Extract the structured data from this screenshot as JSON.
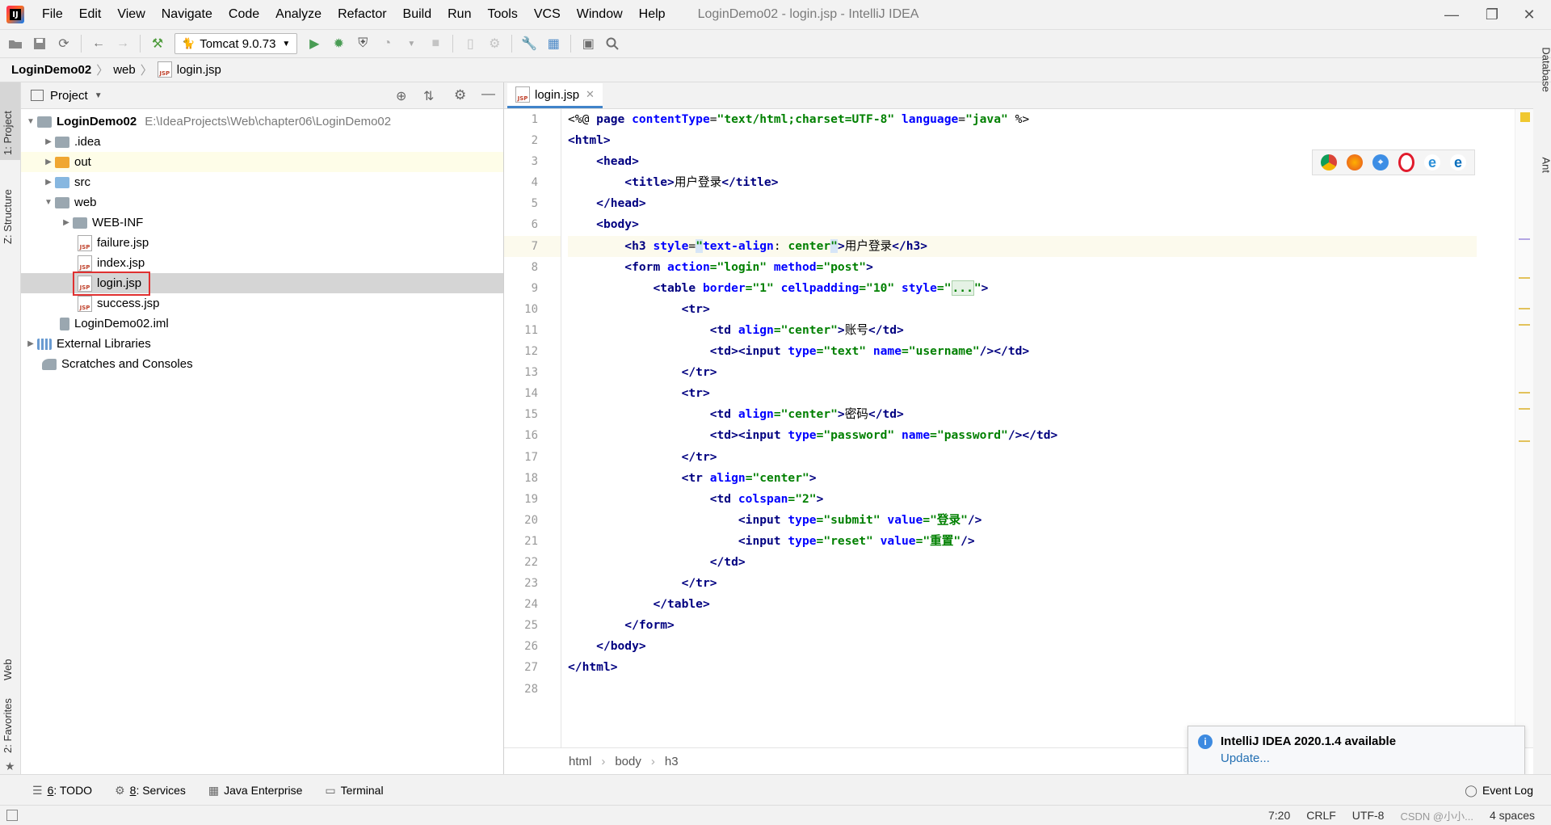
{
  "window": {
    "title": "LoginDemo02 - login.jsp - IntelliJ IDEA",
    "logo_text": "IJ",
    "controls": [
      "—",
      "❐",
      "✕"
    ]
  },
  "menu": [
    "File",
    "Edit",
    "View",
    "Navigate",
    "Code",
    "Analyze",
    "Refactor",
    "Build",
    "Run",
    "Tools",
    "VCS",
    "Window",
    "Help"
  ],
  "toolbar": {
    "run_config": "Tomcat 9.0.73"
  },
  "navbar": {
    "crumbs": [
      "LoginDemo02",
      "web",
      "login.jsp"
    ]
  },
  "left_strip": {
    "project_tab": "1: Project",
    "structure_tab": "Z: Structure",
    "web_tab": "Web",
    "favorites_tab": "2: Favorites"
  },
  "right_strip": {
    "database_tab": "Database",
    "ant_tab": "Ant"
  },
  "project_panel": {
    "title": "Project",
    "tree": [
      {
        "label": "LoginDemo02",
        "path": "E:\\IdeaProjects\\Web\\chapter06\\LoginDemo02",
        "icon": "module-folder"
      },
      {
        "label": ".idea",
        "icon": "folder"
      },
      {
        "label": "out",
        "icon": "folder-orange"
      },
      {
        "label": "src",
        "icon": "folder-blue"
      },
      {
        "label": "web",
        "icon": "web-folder"
      },
      {
        "label": "WEB-INF",
        "icon": "folder"
      },
      {
        "label": "failure.jsp",
        "icon": "jsp-file"
      },
      {
        "label": "index.jsp",
        "icon": "jsp-file"
      },
      {
        "label": "login.jsp",
        "icon": "jsp-file"
      },
      {
        "label": "success.jsp",
        "icon": "jsp-file"
      },
      {
        "label": "LoginDemo02.iml",
        "icon": "iml-file"
      },
      {
        "label": "External Libraries",
        "icon": "library"
      },
      {
        "label": "Scratches and Consoles",
        "icon": "scratches"
      }
    ],
    "jsp_badge": "JSP"
  },
  "editor": {
    "tab": "login.jsp",
    "line_numbers": [
      "1",
      "2",
      "3",
      "4",
      "5",
      "6",
      "7",
      "8",
      "9",
      "10",
      "11",
      "12",
      "13",
      "14",
      "15",
      "16",
      "17",
      "18",
      "19",
      "20",
      "21",
      "22",
      "23",
      "24",
      "25",
      "26",
      "27",
      "28"
    ],
    "code": {
      "l1": {
        "a": "<%@ ",
        "b": "page ",
        "c": "contentType",
        "d": "=",
        "e": "\"text/html;charset=UTF-8\"",
        "f": " language",
        "g": "=",
        "h": "\"java\"",
        "i": " %>"
      },
      "l2": "<html>",
      "l3": "<head>",
      "l4": {
        "open": "<title>",
        "text": "用户登录",
        "close": "</title>"
      },
      "l5": "</head>",
      "l6": "<body>",
      "l7": {
        "open": "<h3 ",
        "attr": "style",
        "eq": "=",
        "q1": "\"",
        "v1": "text-align",
        "colon": ": ",
        "v2": "center",
        "q2": "\"",
        "gt": ">",
        "text": "用户登录",
        "close": "</h3>"
      },
      "l8": {
        "open": "<form ",
        "a1": "action",
        "v1": "=\"login\"",
        "a2": " method",
        "v2": "=\"post\"",
        "gt": ">"
      },
      "l9": {
        "open": "<table ",
        "a1": "border",
        "v1": "=\"1\"",
        "a2": " cellpadding",
        "v2": "=\"10\"",
        "a3": " style",
        "v3": "=\"",
        "fold": "...",
        "q": "\"",
        "gt": ">"
      },
      "l10": "<tr>",
      "l11": {
        "open": "<td ",
        "a1": "align",
        "v1": "=\"center\"",
        "gt": ">",
        "text": "账号",
        "close": "</td>"
      },
      "l12": {
        "td": "<td>",
        "open": "<input ",
        "a1": "type",
        "v1": "=\"text\"",
        "a2": " name",
        "v2": "=\"username\"",
        "end": "/>",
        "close": "</td>"
      },
      "l13": "</tr>",
      "l14": "<tr>",
      "l15": {
        "open": "<td ",
        "a1": "align",
        "v1": "=\"center\"",
        "gt": ">",
        "text": "密码",
        "close": "</td>"
      },
      "l16": {
        "td": "<td>",
        "open": "<input ",
        "a1": "type",
        "v1": "=\"password\"",
        "a2": " name",
        "v2": "=\"password\"",
        "end": "/>",
        "close": "</td>"
      },
      "l17": "</tr>",
      "l18": {
        "open": "<tr ",
        "a1": "align",
        "v1": "=\"center\"",
        "gt": ">"
      },
      "l19": {
        "open": "<td ",
        "a1": "colspan",
        "v1": "=\"2\"",
        "gt": ">"
      },
      "l20": {
        "open": "<input ",
        "a1": "type",
        "v1": "=\"submit\"",
        "a2": " value",
        "v2": "=\"登录\"",
        "end": "/>"
      },
      "l21": {
        "open": "<input ",
        "a1": "type",
        "v1": "=\"reset\"",
        "a2": " value",
        "v2": "=\"重置\"",
        "end": "/>"
      },
      "l22": "</td>",
      "l23": "</tr>",
      "l24": "</table>",
      "l25": "</form>",
      "l26": "</body>",
      "l27": "</html>"
    },
    "breadcrumb": [
      "html",
      "body",
      "h3"
    ],
    "browsers": [
      "chrome",
      "firefox",
      "safari",
      "opera",
      "internet-explorer",
      "edge"
    ]
  },
  "notification": {
    "title": "IntelliJ IDEA 2020.1.4 available",
    "link": "Update..."
  },
  "bottom_tabs": [
    {
      "key": "6",
      "label": ": TODO"
    },
    {
      "key": "8",
      "label": ": Services"
    },
    {
      "key": "",
      "label": "Java Enterprise"
    },
    {
      "key": "",
      "label": "Terminal"
    }
  ],
  "event_log": "Event Log",
  "status": {
    "position": "7:20",
    "line_sep": "CRLF",
    "encoding": "UTF-8",
    "indent": "4 spaces",
    "watermark": "CSDN @小小..."
  },
  "colors": {
    "tag": "#000080",
    "attribute": "#0000ff",
    "value": "#008000",
    "selection_box": "#e03030",
    "tab_underline": "#4083c9"
  }
}
